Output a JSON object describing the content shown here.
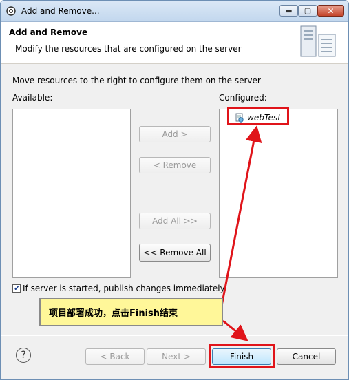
{
  "window": {
    "title": "Add and Remove...",
    "minimize_glyph": "▬",
    "maximize_glyph": "▢",
    "close_glyph": "✕"
  },
  "header": {
    "title": "Add and Remove",
    "description": "Modify the resources that are configured on the server",
    "icon": "server-wizard-icon"
  },
  "body": {
    "instruction": "Move resources to the right to configure them on the server",
    "available_label": "Available:",
    "configured_label": "Configured:",
    "available_items": [],
    "configured_items": [
      {
        "label": "webTest",
        "icon": "web-module-icon"
      }
    ],
    "buttons": {
      "add": "Add >",
      "remove": "< Remove",
      "add_all": "Add All >>",
      "remove_all": "<< Remove All"
    },
    "publish_checkbox": {
      "label": "If server is started, publish changes immediately",
      "checked": true
    }
  },
  "footer": {
    "help_glyph": "?",
    "back": "< Back",
    "next": "Next >",
    "finish": "Finish",
    "cancel": "Cancel"
  },
  "annotation": {
    "callout_text": "项目部署成功，点击Finish结束",
    "highlight_color": "#e0141a",
    "callout_color": "#fff799"
  }
}
